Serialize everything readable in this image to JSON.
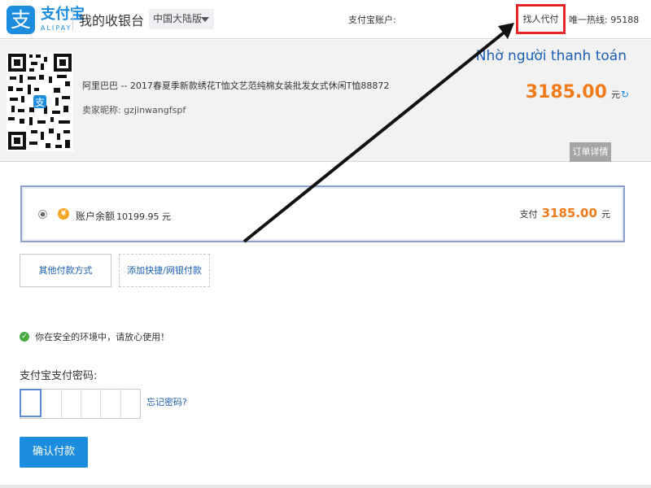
{
  "header": {
    "logo_glyph": "支",
    "logo_text": "支付宝",
    "logo_sub": "ALIPAY",
    "page_title": "我的收银台",
    "region": "中国大陆版",
    "account_label": "支付宝账户:",
    "find_pay_button": "找人代付",
    "hotline": "唯一热线: 95188"
  },
  "summary": {
    "vn_label": "Nhờ người thanh toán",
    "order_title": "阿里巴巴 -- 2017春夏季新款绣花T恤文艺范纯棉女装批发女式休闲T恤88872",
    "merchant": "卖家昵称: gzjinwangfspf",
    "amount": "3185.00",
    "amount_unit": "元",
    "order_detail_tab": "订单详情"
  },
  "payment": {
    "balance_label": "账户余额",
    "balance_value": "10199.95 元",
    "pay_label": "支付",
    "pay_amount": "3185.00",
    "pay_unit": "元",
    "other_methods": "其他付款方式",
    "add_card": "添加快捷/网银付款",
    "safe_text": "你在安全的环境中，请放心使用！",
    "password_label": "支付宝支付密码:",
    "forgot_password": "忘记密码?",
    "confirm": "确认付款"
  },
  "colors": {
    "brand_blue": "#1b8cde",
    "amount_orange": "#f07b1a",
    "highlight_red": "#e52626"
  }
}
